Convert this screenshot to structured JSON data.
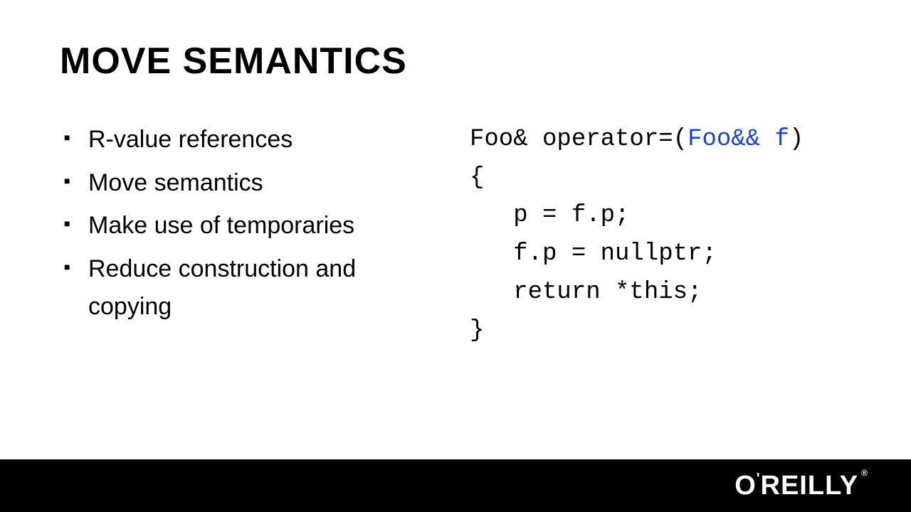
{
  "title": "MOVE SEMANTICS",
  "bullets": [
    "R-value references",
    "Move semantics",
    "Make use of temporaries",
    "Reduce construction and copying"
  ],
  "code": {
    "line1_a": "Foo& operator=(",
    "line1_hl": "Foo&& f",
    "line1_b": ")",
    "line2": "{",
    "line3": "   p = f.p;",
    "line4": "   f.p = nullptr;",
    "line5": "   return *this;",
    "line6": "}"
  },
  "brand": {
    "part1": "O",
    "apos": "'",
    "part2": "REILLY",
    "rmark": "®"
  }
}
